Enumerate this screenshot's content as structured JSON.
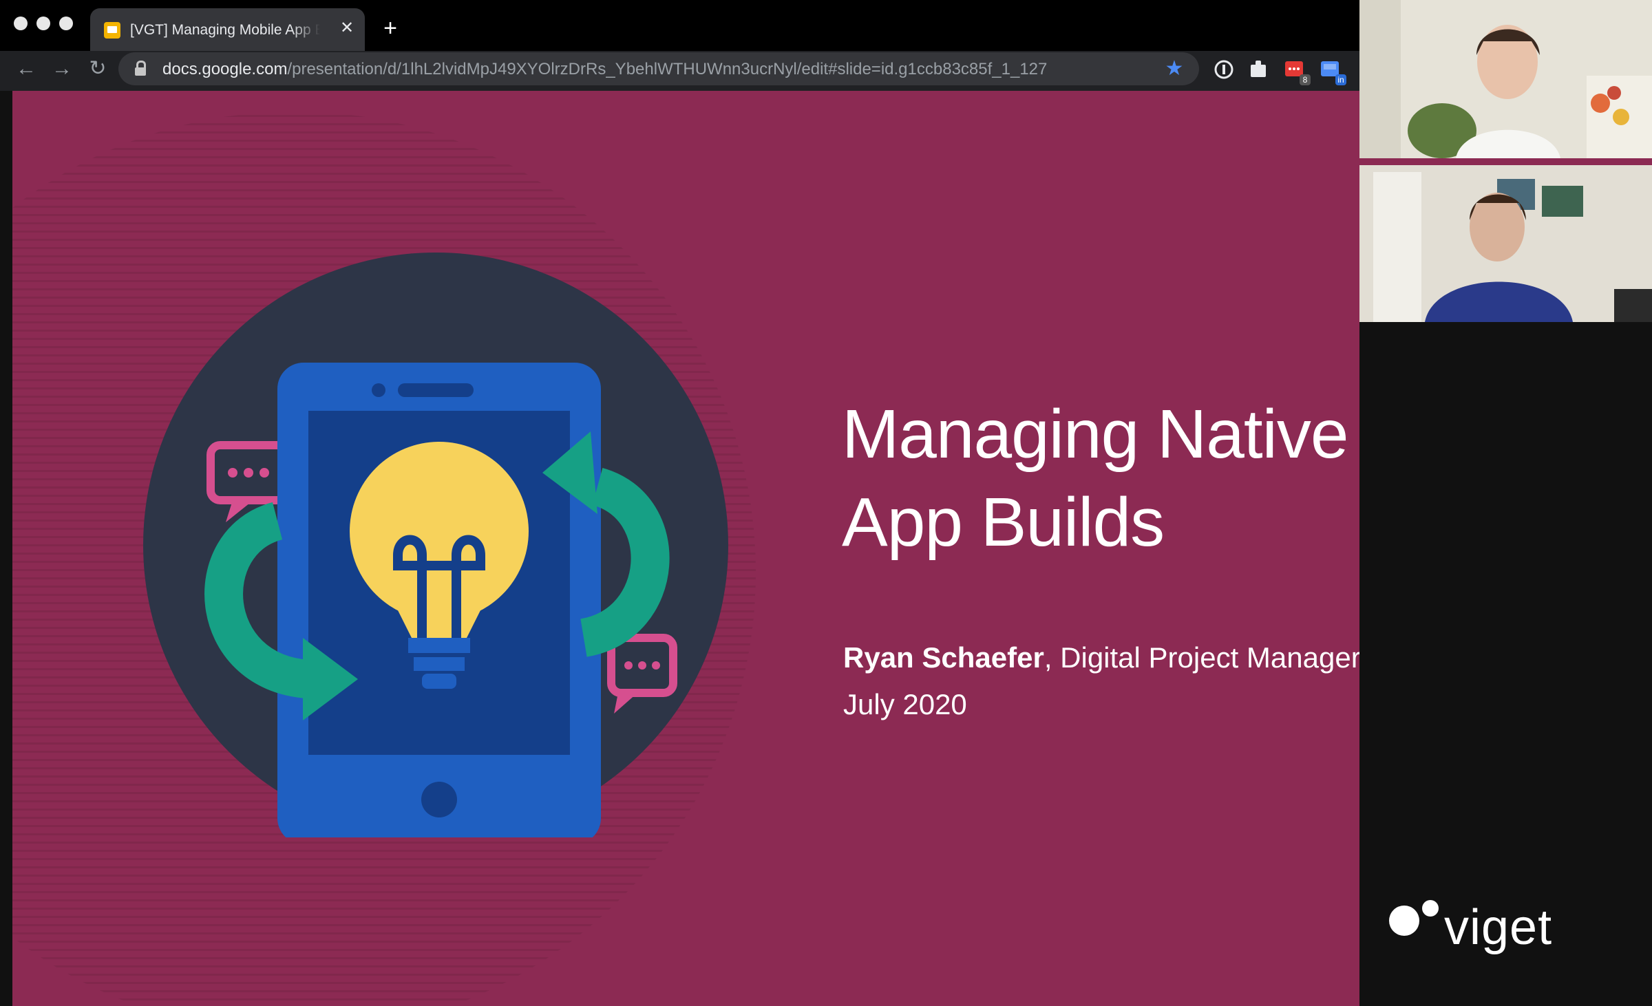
{
  "browser": {
    "tab": {
      "title": "[VGT] Managing Mobile App Builds",
      "close_glyph": "✕"
    },
    "new_tab_glyph": "+",
    "nav": {
      "back_glyph": "←",
      "forward_glyph": "→",
      "reload_glyph": "↻"
    },
    "address_bar": {
      "host": "docs.google.com",
      "path": "/presentation/d/1lhL2lvidMpJ49XYOlrzDrRs_YbehlWTHUWnn3ucrNyl/edit#slide=id.g1ccb83c85f_1_127",
      "bookmark_glyph": "★"
    },
    "extensions": [
      {
        "name": "password-manager-icon",
        "color": "#9aa0a6"
      },
      {
        "name": "puzzle-icon",
        "color": "#e8eaed"
      },
      {
        "name": "todo-extension-icon",
        "color": "#e53935",
        "badge": "8"
      },
      {
        "name": "linkedin-extension-icon",
        "color": "#4c8bf5",
        "badge": "in"
      }
    ]
  },
  "slide": {
    "background": "#8c2a53",
    "title_line1": "Managing Native",
    "title_line2": "App Builds",
    "presenter_name": "Ryan Schaefer",
    "presenter_role": ", Digital Project Manager",
    "date": "July 2020",
    "logo": "viget",
    "colors": {
      "circle": "#2d3547",
      "phone": "#1f5fc1",
      "screen": "#143f8a",
      "bulb": "#f7d25b",
      "arrows": "#16a085",
      "bubbles": "#d64f8f"
    }
  },
  "video_call": {
    "participants": [
      {
        "tile": "participant-1",
        "description": "woman"
      },
      {
        "tile": "participant-2",
        "description": "man"
      }
    ]
  }
}
